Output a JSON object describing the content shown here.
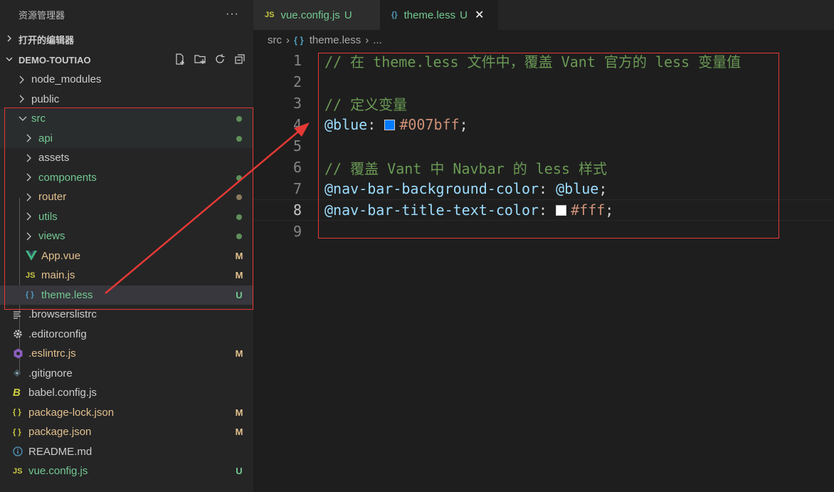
{
  "sidebar": {
    "title": "资源管理器",
    "more": "···",
    "open_editors": "打开的编辑器",
    "project": "DEMO-TOUTIAO",
    "items": [
      {
        "label": "node_modules",
        "badge": ""
      },
      {
        "label": "public",
        "badge": ""
      },
      {
        "label": "src",
        "badge": ""
      },
      {
        "label": "api",
        "badge": ""
      },
      {
        "label": "assets",
        "badge": ""
      },
      {
        "label": "components",
        "badge": ""
      },
      {
        "label": "router",
        "badge": ""
      },
      {
        "label": "utils",
        "badge": ""
      },
      {
        "label": "views",
        "badge": ""
      },
      {
        "label": "App.vue",
        "badge": "M"
      },
      {
        "label": "main.js",
        "badge": "M"
      },
      {
        "label": "theme.less",
        "badge": "U"
      },
      {
        "label": ".browserslistrc",
        "badge": ""
      },
      {
        "label": ".editorconfig",
        "badge": ""
      },
      {
        "label": ".eslintrc.js",
        "badge": "M"
      },
      {
        "label": ".gitignore",
        "badge": ""
      },
      {
        "label": "babel.config.js",
        "badge": ""
      },
      {
        "label": "package-lock.json",
        "badge": "M"
      },
      {
        "label": "package.json",
        "badge": "M"
      },
      {
        "label": "README.md",
        "badge": ""
      },
      {
        "label": "vue.config.js",
        "badge": "U"
      }
    ]
  },
  "tabs": [
    {
      "icon": "JS",
      "label": "vue.config.js",
      "mark": "U"
    },
    {
      "icon": "{}",
      "label": "theme.less",
      "mark": "U",
      "close": "✕"
    }
  ],
  "breadcrumb": {
    "folder": "src",
    "file": "theme.less",
    "more": "..."
  },
  "editor": {
    "line_numbers": [
      "1",
      "2",
      "3",
      "4",
      "5",
      "6",
      "7",
      "8",
      "9"
    ],
    "lines": {
      "l1": "// 在 theme.less 文件中，覆盖 Vant 官方的 less 变量值",
      "l3": "// 定义变量",
      "l4_var": "@blue",
      "l4_colon": ": ",
      "l4_val": "#007bff",
      "l4_end": ";",
      "l6": "// 覆盖 Vant 中 Navbar 的 less 样式",
      "l7_var": "@nav-bar-background-color",
      "l7_colon": ": ",
      "l7_ref": "@blue",
      "l7_end": ";",
      "l8_var": "@nav-bar-title-text-color",
      "l8_colon": ": ",
      "l8_val": "#fff",
      "l8_end": ";"
    },
    "swatch_colors": {
      "blue": "#007bff",
      "white": "#ffffff"
    }
  },
  "colors": {
    "annotation_red": "#e53935",
    "untracked_green": "#73c991",
    "modified": "#e2c08d"
  }
}
